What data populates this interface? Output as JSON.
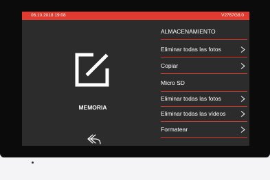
{
  "status_bar": {
    "datetime": "06.10.2018  19:08",
    "firmware": "V2767G8.0"
  },
  "left_panel": {
    "title": "MEMORIA",
    "icon": "edit-icon",
    "back_icon": "back-arrow-icon"
  },
  "menu": {
    "section1_title": "ALMACENAMIENTO",
    "items1": [
      {
        "label": "Eliminar todas las fotos"
      },
      {
        "label": "Copiar"
      }
    ],
    "section2_title": "Micro SD",
    "items2": [
      {
        "label": "Eliminar todas las fotos"
      },
      {
        "label": "Eliminar todas las vídeos"
      },
      {
        "label": "Formatear"
      }
    ]
  },
  "colors": {
    "accent": "#e23a2e",
    "screen_bg": "#2c2c2c",
    "bezel": "#0b0b0b"
  }
}
